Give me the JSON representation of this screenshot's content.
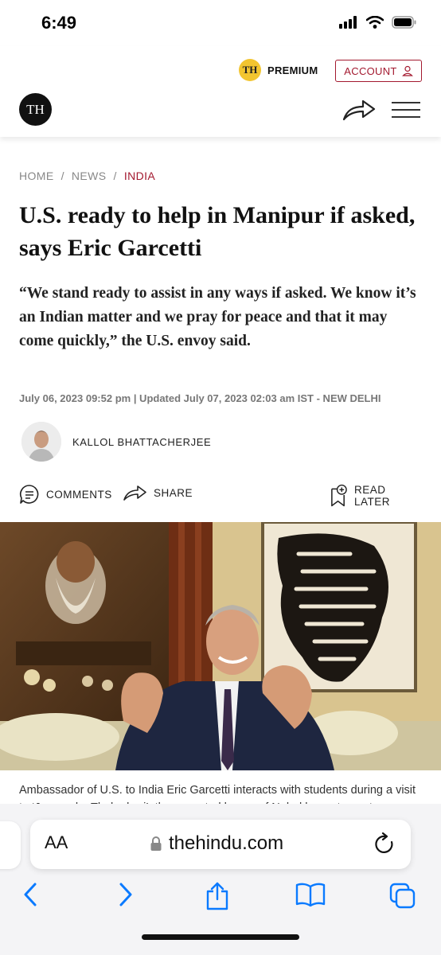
{
  "status": {
    "time": "6:49"
  },
  "header": {
    "premium_logo": "TH",
    "premium_label": "PREMIUM",
    "account_label": "ACCOUNT",
    "site_logo": "TH"
  },
  "breadcrumb": {
    "home": "HOME",
    "sep1": "/",
    "news": "NEWS",
    "sep2": "/",
    "section": "INDIA"
  },
  "article": {
    "headline": "U.S. ready to help in Manipur if asked, says Eric Garcetti",
    "subhead": "“We stand ready to assist in any ways if asked. We know it’s an Indian matter and we pray for peace and that it may come quickly,” the U.S. envoy said.",
    "dateline": "July 06, 2023 09:52 pm | Updated July 07, 2023 02:03 am IST - NEW DELHI",
    "author": "KALLOL BHATTACHERJEE",
    "caption": "Ambassador of U.S. to India Eric Garcetti interacts with students during a visit to ‘Jorasanko Thakurbari’, the ancestral house of Nobel laureate poet"
  },
  "actions": {
    "comments": "COMMENTS",
    "share": "SHARE",
    "read_later": "READ LATER"
  },
  "browser": {
    "text_size": "AA",
    "url": "thehindu.com"
  },
  "colors": {
    "brand_red": "#a3192f",
    "premium_yellow": "#f2c530",
    "ios_blue": "#0a7aff"
  },
  "icons": [
    "signal-icon",
    "wifi-icon",
    "battery-icon",
    "user-icon",
    "share-arrow-icon",
    "hamburger-menu-icon",
    "comment-icon",
    "bookmark-plus-icon",
    "lock-icon",
    "reload-icon",
    "back-icon",
    "forward-icon",
    "share-sheet-icon",
    "bookmarks-icon",
    "tabs-icon"
  ]
}
